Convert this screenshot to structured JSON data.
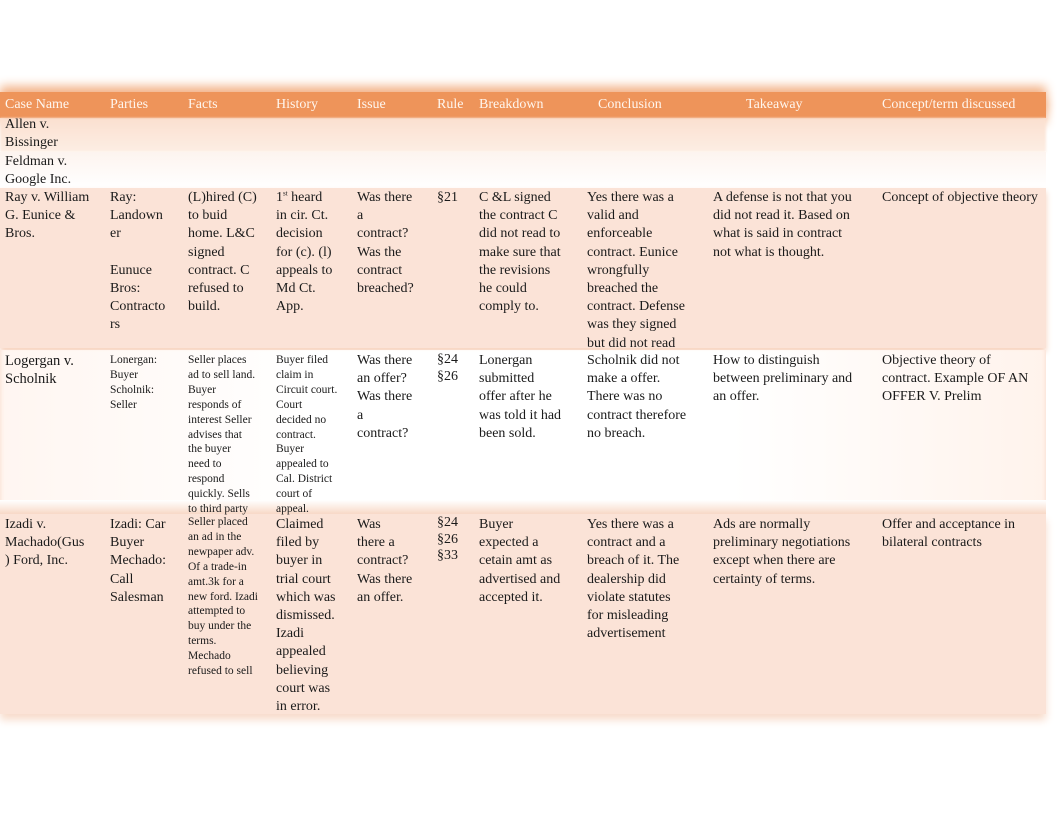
{
  "table": {
    "headers": [
      "Case Name",
      "Parties",
      "Facts",
      "History",
      "Issue",
      "Rule",
      "Breakdown",
      "Conclusion",
      "Takeaway",
      "Concept/term discussed"
    ],
    "rows": [
      {
        "case_name": "Allen v.\nBissinger",
        "parties": "",
        "facts": "",
        "history": "",
        "issue": "",
        "rule": "",
        "breakdown": "",
        "conclusion": "",
        "takeaway": "",
        "concept": ""
      },
      {
        "case_name": "Feldman v.\nGoogle Inc.",
        "parties": "",
        "facts": "",
        "history": "",
        "issue": "",
        "rule": "",
        "breakdown": "",
        "conclusion": "",
        "takeaway": "",
        "concept": ""
      },
      {
        "case_name": "Ray v. William\nG. Eunice &\nBros.",
        "parties": "Ray:\nLandown\ner\n\nEunuce\nBros:\nContracto\nrs",
        "facts": "(L)hired (C)\nto buid\nhome. L&C\nsigned\ncontract. C\nrefused to\nbuild.",
        "history_ordinal": "1",
        "history_sup": "st",
        "history": " heard\nin cir. Ct.\ndecision\nfor (c). (l)\nappeals to\nMd Ct.\nApp.",
        "issue": "Was there\na\ncontract?\nWas the\ncontract\nbreached?",
        "rule": "§21",
        "breakdown": "C &L signed\nthe contract C\ndid not read to\nmake sure that\nthe revisions\nhe could\ncomply to.",
        "conclusion": "Yes there was a\nvalid and\nenforceable\ncontract. Eunice\nwrongfully\nbreached the\ncontract. Defense\nwas they signed\nbut did not read",
        "takeaway": "A defense is not that you\ndid not read it. Based on\nwhat is said in contract\nnot what is thought.",
        "concept": "Concept of objective theory"
      },
      {
        "case_name": "Logergan v.\nScholnik",
        "parties": "Lonergan:\nBuyer\nScholnik:\nSeller",
        "facts": "Seller places\nad to sell land.\nBuyer\nresponds of\ninterest Seller\nadvises that\nthe buyer\nneed to\nrespond\nquickly. Sells\nto third party",
        "history": "Buyer filed\nclaim in\nCircuit court.\nCourt\ndecided no\ncontract.\nBuyer\nappealed to\nCal. District\ncourt of\nappeal.",
        "issue": "Was there\nan offer?\nWas there\na\ncontract?",
        "rule": "§24\n§26",
        "breakdown": "Lonergan\nsubmitted\noffer after he\nwas told it had\nbeen sold.",
        "conclusion": "Scholnik did not\nmake a offer.\nThere was no\ncontract therefore\nno breach.",
        "takeaway": "How to distinguish\nbetween preliminary and\nan offer.",
        "concept": "Objective theory of\ncontract. Example OF AN\nOFFER V. Prelim"
      },
      {
        "case_name": "Izadi v.\nMachado(Gus\n) Ford, Inc.",
        "parties": "Izadi: Car\nBuyer\nMechado:\nCall\nSalesman",
        "facts": "Seller placed\nan ad in the\nnewpaper adv.\nOf a trade-in\namt.3k   for a\nnew ford. Izadi\nattempted to\nbuy under the\nterms.\nMechado\nrefused to sell",
        "history": "Claimed\nfiled by\nbuyer in\ntrial court\nwhich was\ndismissed.\nIzadi\nappealed\nbelieving\ncourt was\nin error.",
        "issue": "Was\n there a\ncontract?\nWas there\nan offer.",
        "rule": "§24\n§26\n§33",
        "breakdown": "Buyer\nexpected   a\ncetain amt as\nadvertised and\naccepted it.",
        "conclusion": "Yes there was a\ncontract and a\nbreach of it. The\ndealership did\nviolate statutes\nfor misleading\nadvertisement",
        "takeaway": "Ads are normally\npreliminary negotiations\nexcept when there are\ncertainty of terms.",
        "concept": "Offer and acceptance in\nbilateral contracts"
      }
    ]
  },
  "colors": {
    "header_band": "#ee945a",
    "header_text": "#fff6ee",
    "row_tint": "#fbe3d7"
  }
}
